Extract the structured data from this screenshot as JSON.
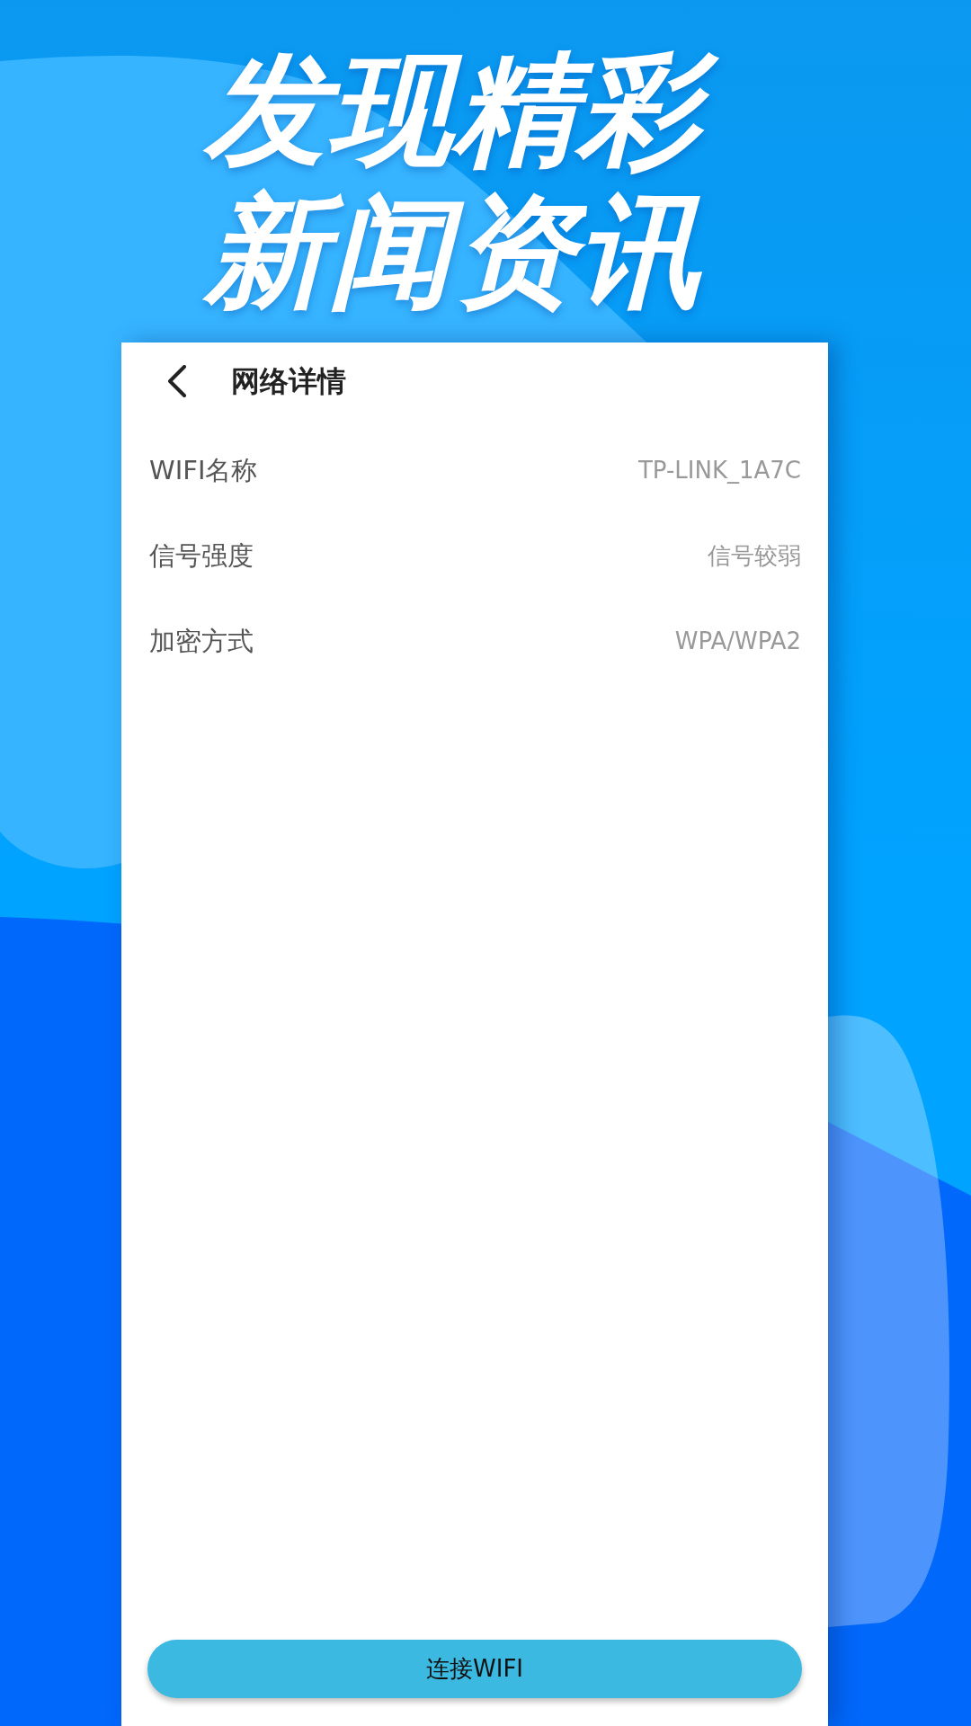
{
  "headline": [
    "发现精彩",
    "新闻资讯"
  ],
  "header": {
    "title": "网络详情"
  },
  "details": [
    {
      "label": "WIFI名称",
      "value": "TP-LINK_1A7C"
    },
    {
      "label": "信号强度",
      "value": "信号较弱"
    },
    {
      "label": "加密方式",
      "value": "WPA/WPA2"
    }
  ],
  "connect_button": {
    "label": "连接WIFI"
  }
}
